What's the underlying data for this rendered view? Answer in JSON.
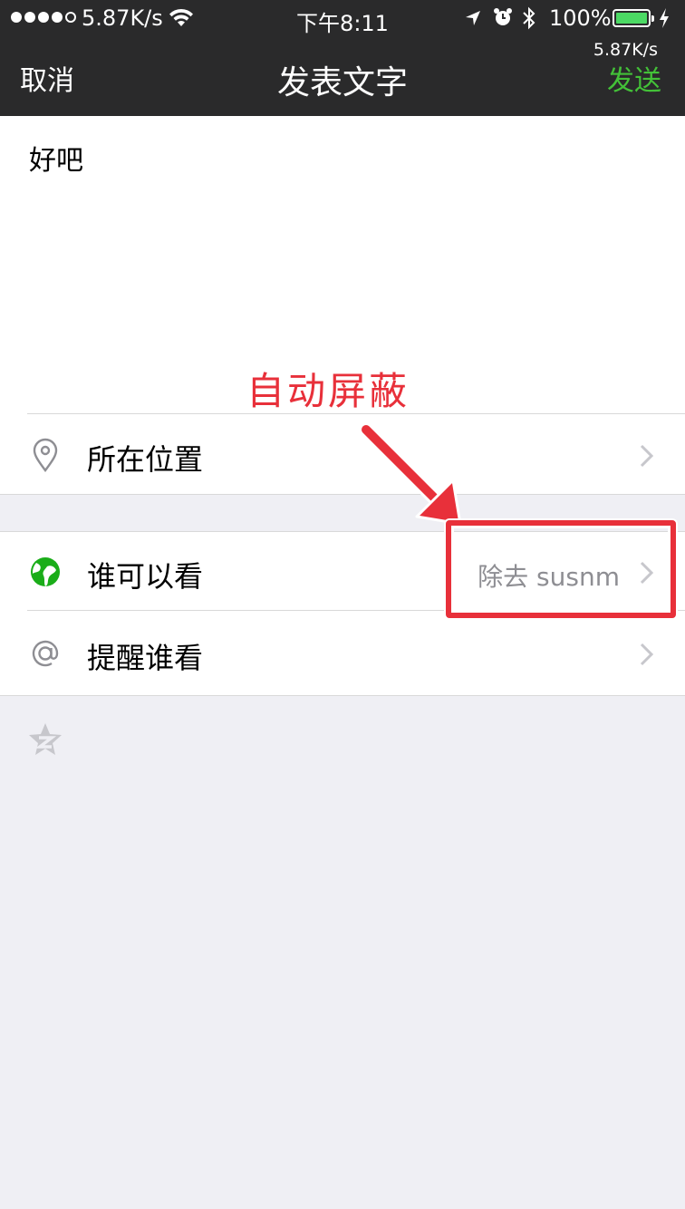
{
  "status_bar": {
    "net_speed": "5.87K/s",
    "time": "下午8:11",
    "battery": "100%",
    "net_speed_nav": "5.87K/s"
  },
  "nav": {
    "cancel": "取消",
    "title": "发表文字",
    "send": "发送",
    "send_color": "#43c138"
  },
  "compose": {
    "text": "好吧"
  },
  "rows": {
    "location": {
      "label": "所在位置",
      "icon": "location-pin-icon"
    },
    "visibility": {
      "label": "谁可以看",
      "value": "除去 susnm",
      "icon": "globe-icon"
    },
    "remind": {
      "label": "提醒谁看",
      "icon": "at-icon"
    }
  },
  "annotation": {
    "text": "自动屏蔽",
    "color": "#e8303a"
  }
}
